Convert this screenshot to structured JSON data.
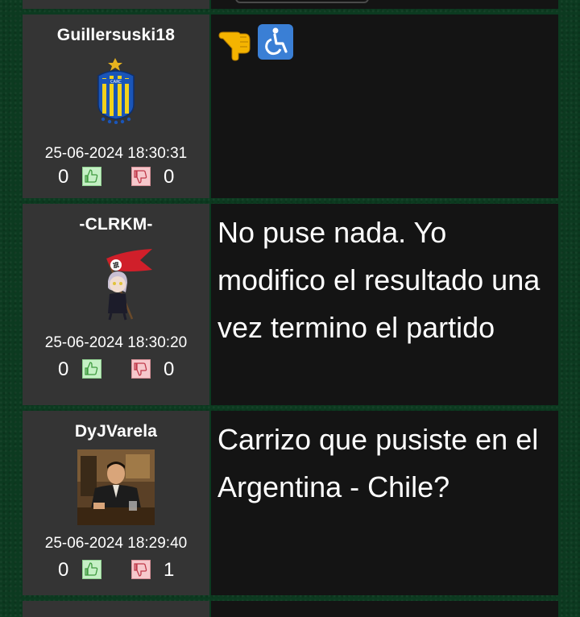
{
  "posts": [
    {
      "username": "Guillersuski18",
      "avatar": "rosario-central-crest-icon",
      "timestamp": "25-06-2024 18:30:31",
      "likes": "0",
      "dislikes": "0",
      "message": "",
      "emojis": [
        "point-left-icon",
        "wheelchair-icon"
      ]
    },
    {
      "username": "-CLRKM-",
      "avatar": "flag-character-icon",
      "timestamp": "25-06-2024 18:30:20",
      "likes": "0",
      "dislikes": "0",
      "message": "No puse nada. Yo modifico el resultado una vez termino el partido"
    },
    {
      "username": "DyJVarela",
      "avatar": "man-at-desk-photo",
      "timestamp": "25-06-2024 18:29:40",
      "likes": "0",
      "dislikes": "1",
      "message": "Carrizo que pusiste en el Argentina - Chile?"
    }
  ],
  "colors": {
    "background": "#0c3a20",
    "user_panel": "#343434",
    "message_panel": "#141414",
    "like_button": "#c5f0c5",
    "dislike_button": "#f6c8cc"
  }
}
